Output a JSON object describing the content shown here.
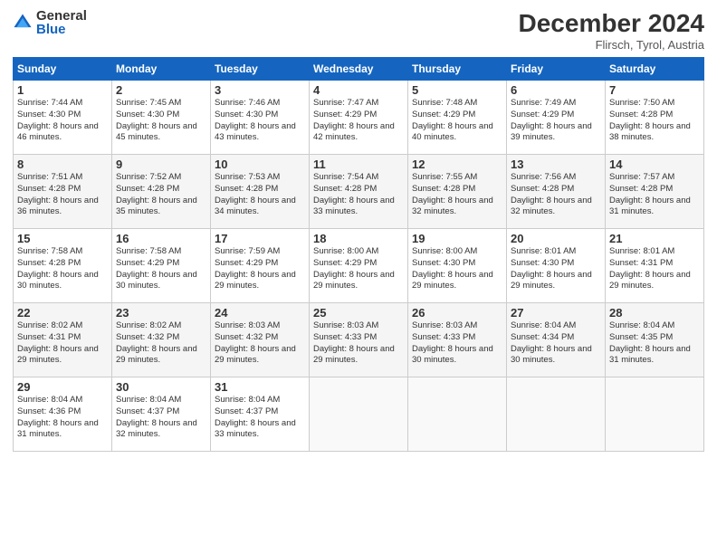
{
  "logo": {
    "general": "General",
    "blue": "Blue"
  },
  "title": "December 2024",
  "location": "Flirsch, Tyrol, Austria",
  "days_of_week": [
    "Sunday",
    "Monday",
    "Tuesday",
    "Wednesday",
    "Thursday",
    "Friday",
    "Saturday"
  ],
  "weeks": [
    [
      {
        "day": "1",
        "sunrise": "Sunrise: 7:44 AM",
        "sunset": "Sunset: 4:30 PM",
        "daylight": "Daylight: 8 hours and 46 minutes."
      },
      {
        "day": "2",
        "sunrise": "Sunrise: 7:45 AM",
        "sunset": "Sunset: 4:30 PM",
        "daylight": "Daylight: 8 hours and 45 minutes."
      },
      {
        "day": "3",
        "sunrise": "Sunrise: 7:46 AM",
        "sunset": "Sunset: 4:30 PM",
        "daylight": "Daylight: 8 hours and 43 minutes."
      },
      {
        "day": "4",
        "sunrise": "Sunrise: 7:47 AM",
        "sunset": "Sunset: 4:29 PM",
        "daylight": "Daylight: 8 hours and 42 minutes."
      },
      {
        "day": "5",
        "sunrise": "Sunrise: 7:48 AM",
        "sunset": "Sunset: 4:29 PM",
        "daylight": "Daylight: 8 hours and 40 minutes."
      },
      {
        "day": "6",
        "sunrise": "Sunrise: 7:49 AM",
        "sunset": "Sunset: 4:29 PM",
        "daylight": "Daylight: 8 hours and 39 minutes."
      },
      {
        "day": "7",
        "sunrise": "Sunrise: 7:50 AM",
        "sunset": "Sunset: 4:28 PM",
        "daylight": "Daylight: 8 hours and 38 minutes."
      }
    ],
    [
      {
        "day": "8",
        "sunrise": "Sunrise: 7:51 AM",
        "sunset": "Sunset: 4:28 PM",
        "daylight": "Daylight: 8 hours and 36 minutes."
      },
      {
        "day": "9",
        "sunrise": "Sunrise: 7:52 AM",
        "sunset": "Sunset: 4:28 PM",
        "daylight": "Daylight: 8 hours and 35 minutes."
      },
      {
        "day": "10",
        "sunrise": "Sunrise: 7:53 AM",
        "sunset": "Sunset: 4:28 PM",
        "daylight": "Daylight: 8 hours and 34 minutes."
      },
      {
        "day": "11",
        "sunrise": "Sunrise: 7:54 AM",
        "sunset": "Sunset: 4:28 PM",
        "daylight": "Daylight: 8 hours and 33 minutes."
      },
      {
        "day": "12",
        "sunrise": "Sunrise: 7:55 AM",
        "sunset": "Sunset: 4:28 PM",
        "daylight": "Daylight: 8 hours and 32 minutes."
      },
      {
        "day": "13",
        "sunrise": "Sunrise: 7:56 AM",
        "sunset": "Sunset: 4:28 PM",
        "daylight": "Daylight: 8 hours and 32 minutes."
      },
      {
        "day": "14",
        "sunrise": "Sunrise: 7:57 AM",
        "sunset": "Sunset: 4:28 PM",
        "daylight": "Daylight: 8 hours and 31 minutes."
      }
    ],
    [
      {
        "day": "15",
        "sunrise": "Sunrise: 7:58 AM",
        "sunset": "Sunset: 4:28 PM",
        "daylight": "Daylight: 8 hours and 30 minutes."
      },
      {
        "day": "16",
        "sunrise": "Sunrise: 7:58 AM",
        "sunset": "Sunset: 4:29 PM",
        "daylight": "Daylight: 8 hours and 30 minutes."
      },
      {
        "day": "17",
        "sunrise": "Sunrise: 7:59 AM",
        "sunset": "Sunset: 4:29 PM",
        "daylight": "Daylight: 8 hours and 29 minutes."
      },
      {
        "day": "18",
        "sunrise": "Sunrise: 8:00 AM",
        "sunset": "Sunset: 4:29 PM",
        "daylight": "Daylight: 8 hours and 29 minutes."
      },
      {
        "day": "19",
        "sunrise": "Sunrise: 8:00 AM",
        "sunset": "Sunset: 4:30 PM",
        "daylight": "Daylight: 8 hours and 29 minutes."
      },
      {
        "day": "20",
        "sunrise": "Sunrise: 8:01 AM",
        "sunset": "Sunset: 4:30 PM",
        "daylight": "Daylight: 8 hours and 29 minutes."
      },
      {
        "day": "21",
        "sunrise": "Sunrise: 8:01 AM",
        "sunset": "Sunset: 4:31 PM",
        "daylight": "Daylight: 8 hours and 29 minutes."
      }
    ],
    [
      {
        "day": "22",
        "sunrise": "Sunrise: 8:02 AM",
        "sunset": "Sunset: 4:31 PM",
        "daylight": "Daylight: 8 hours and 29 minutes."
      },
      {
        "day": "23",
        "sunrise": "Sunrise: 8:02 AM",
        "sunset": "Sunset: 4:32 PM",
        "daylight": "Daylight: 8 hours and 29 minutes."
      },
      {
        "day": "24",
        "sunrise": "Sunrise: 8:03 AM",
        "sunset": "Sunset: 4:32 PM",
        "daylight": "Daylight: 8 hours and 29 minutes."
      },
      {
        "day": "25",
        "sunrise": "Sunrise: 8:03 AM",
        "sunset": "Sunset: 4:33 PM",
        "daylight": "Daylight: 8 hours and 29 minutes."
      },
      {
        "day": "26",
        "sunrise": "Sunrise: 8:03 AM",
        "sunset": "Sunset: 4:33 PM",
        "daylight": "Daylight: 8 hours and 30 minutes."
      },
      {
        "day": "27",
        "sunrise": "Sunrise: 8:04 AM",
        "sunset": "Sunset: 4:34 PM",
        "daylight": "Daylight: 8 hours and 30 minutes."
      },
      {
        "day": "28",
        "sunrise": "Sunrise: 8:04 AM",
        "sunset": "Sunset: 4:35 PM",
        "daylight": "Daylight: 8 hours and 31 minutes."
      }
    ],
    [
      {
        "day": "29",
        "sunrise": "Sunrise: 8:04 AM",
        "sunset": "Sunset: 4:36 PM",
        "daylight": "Daylight: 8 hours and 31 minutes."
      },
      {
        "day": "30",
        "sunrise": "Sunrise: 8:04 AM",
        "sunset": "Sunset: 4:37 PM",
        "daylight": "Daylight: 8 hours and 32 minutes."
      },
      {
        "day": "31",
        "sunrise": "Sunrise: 8:04 AM",
        "sunset": "Sunset: 4:37 PM",
        "daylight": "Daylight: 8 hours and 33 minutes."
      },
      null,
      null,
      null,
      null
    ]
  ]
}
